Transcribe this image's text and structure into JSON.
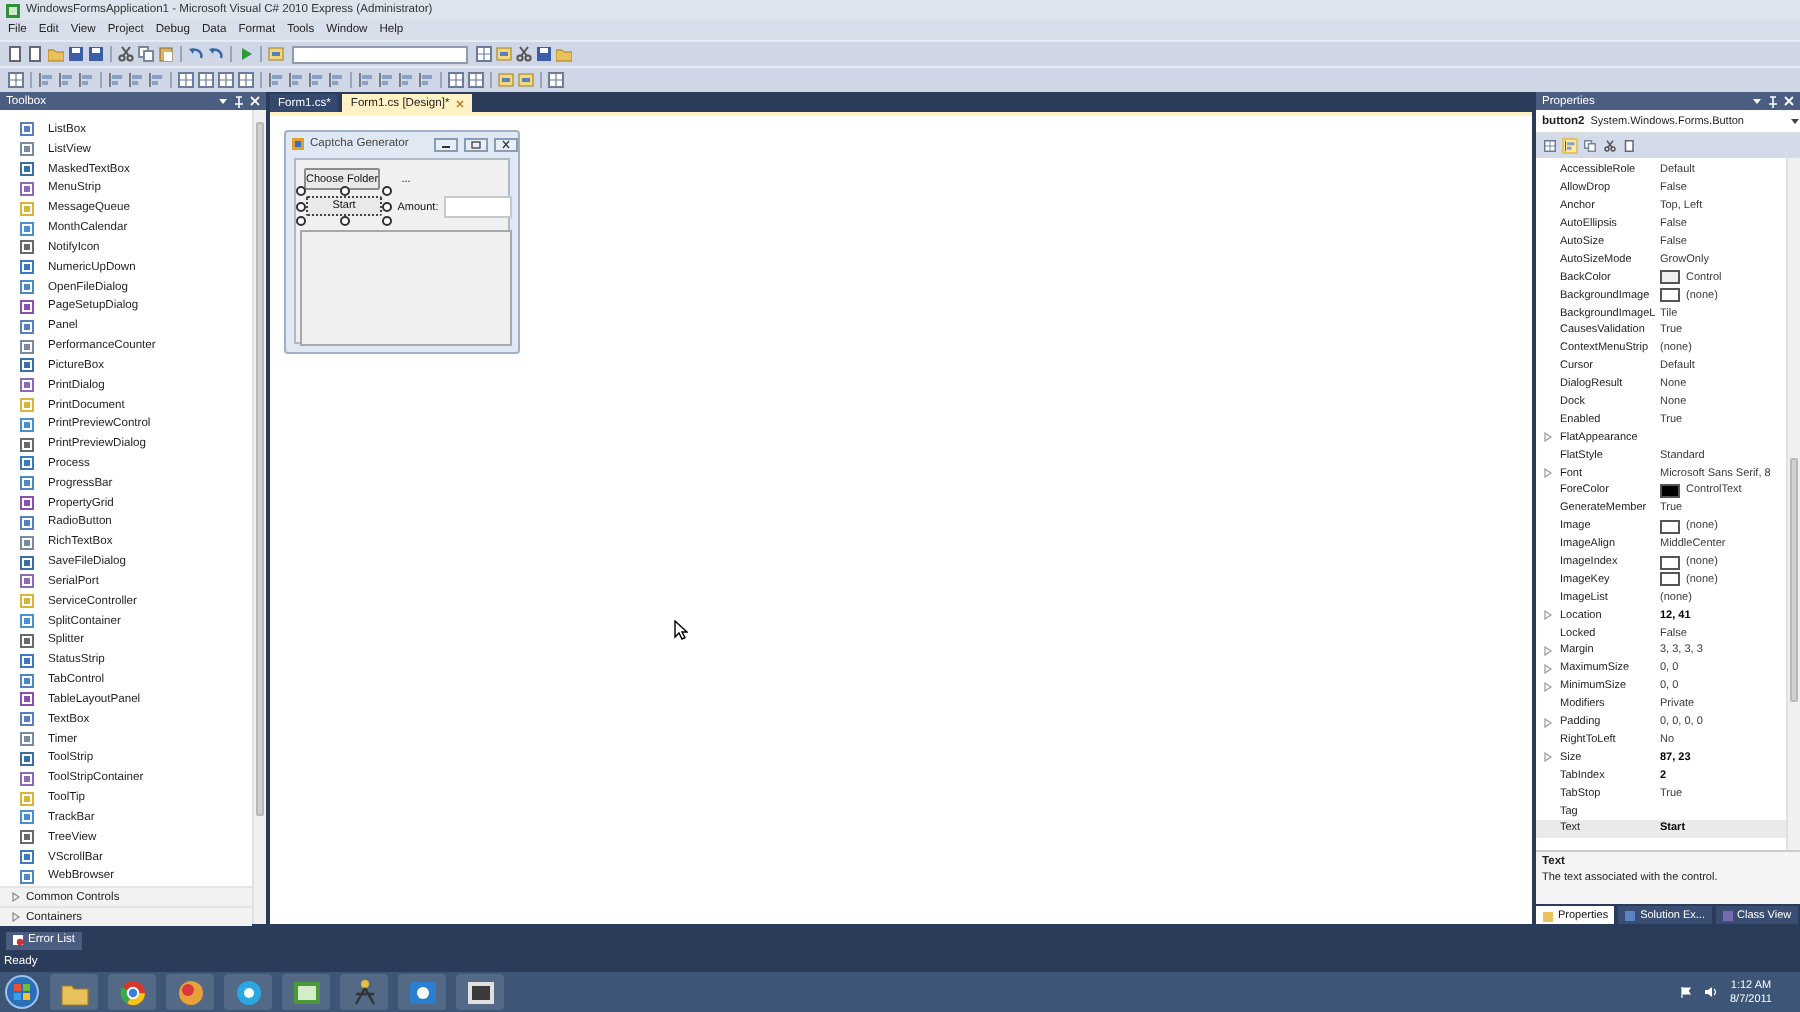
{
  "window": {
    "title": "WindowsFormsApplication1 - Microsoft Visual C# 2010 Express (Administrator)"
  },
  "menu": [
    "File",
    "Edit",
    "View",
    "Project",
    "Debug",
    "Data",
    "Format",
    "Tools",
    "Window",
    "Help"
  ],
  "toolbox": {
    "title": "Toolbox",
    "items": [
      "ListBox",
      "ListView",
      "MaskedTextBox",
      "MenuStrip",
      "MessageQueue",
      "MonthCalendar",
      "NotifyIcon",
      "NumericUpDown",
      "OpenFileDialog",
      "PageSetupDialog",
      "Panel",
      "PerformanceCounter",
      "PictureBox",
      "PrintDialog",
      "PrintDocument",
      "PrintPreviewControl",
      "PrintPreviewDialog",
      "Process",
      "ProgressBar",
      "PropertyGrid",
      "RadioButton",
      "RichTextBox",
      "SaveFileDialog",
      "SerialPort",
      "ServiceController",
      "SplitContainer",
      "Splitter",
      "StatusStrip",
      "TabControl",
      "TableLayoutPanel",
      "TextBox",
      "Timer",
      "ToolStrip",
      "ToolStripContainer",
      "ToolTip",
      "TrackBar",
      "TreeView",
      "VScrollBar",
      "WebBrowser"
    ],
    "groups": [
      {
        "label": "Common Controls",
        "expanded": false
      },
      {
        "label": "Containers",
        "expanded": false
      }
    ]
  },
  "documents": {
    "tabs": [
      {
        "label": "Form1.cs*",
        "selected": false
      },
      {
        "label": "Form1.cs [Design]*",
        "selected": true
      }
    ]
  },
  "form": {
    "title": "Captcha Generator",
    "controls": [
      {
        "kind": "button",
        "text": "Choose Folder",
        "selected": false
      },
      {
        "kind": "label",
        "text": "..."
      },
      {
        "kind": "button",
        "text": "Start",
        "selected": true
      },
      {
        "kind": "label",
        "text": "Amount:"
      },
      {
        "kind": "textbox"
      },
      {
        "kind": "listbox"
      }
    ]
  },
  "properties": {
    "title": "Properties",
    "object_name": "button2",
    "object_type": "System.Windows.Forms.Button",
    "view_buttons": [
      {
        "selected": false
      },
      {
        "selected": true
      },
      {
        "selected": false
      },
      {
        "selected": false
      },
      {
        "selected": false
      }
    ],
    "rows": [
      {
        "name": "AccessibleRole",
        "value": "Default",
        "expandable": false,
        "modified": false,
        "selected": false
      },
      {
        "name": "AllowDrop",
        "value": "False",
        "expandable": false,
        "modified": false,
        "selected": false
      },
      {
        "name": "Anchor",
        "value": "Top, Left",
        "expandable": false,
        "modified": false,
        "selected": false
      },
      {
        "name": "AutoEllipsis",
        "value": "False",
        "expandable": false,
        "modified": false,
        "selected": false
      },
      {
        "name": "AutoSize",
        "value": "False",
        "expandable": false,
        "modified": false,
        "selected": false
      },
      {
        "name": "AutoSizeMode",
        "value": "GrowOnly",
        "expandable": false,
        "modified": false,
        "selected": false
      },
      {
        "name": "BackColor",
        "value": "Control",
        "color": "#f0f0f0",
        "expandable": false,
        "modified": false,
        "selected": false
      },
      {
        "name": "BackgroundImage",
        "value": "(none)",
        "color": "#ffffff",
        "expandable": false,
        "modified": false,
        "selected": false
      },
      {
        "name": "BackgroundImageL",
        "value": "Tile",
        "expandable": false,
        "modified": false,
        "selected": false
      },
      {
        "name": "CausesValidation",
        "value": "True",
        "expandable": false,
        "modified": false,
        "selected": false
      },
      {
        "name": "ContextMenuStrip",
        "value": "(none)",
        "expandable": false,
        "modified": false,
        "selected": false
      },
      {
        "name": "Cursor",
        "value": "Default",
        "expandable": false,
        "modified": false,
        "selected": false
      },
      {
        "name": "DialogResult",
        "value": "None",
        "expandable": false,
        "modified": false,
        "selected": false
      },
      {
        "name": "Dock",
        "value": "None",
        "expandable": false,
        "modified": false,
        "selected": false
      },
      {
        "name": "Enabled",
        "value": "True",
        "expandable": false,
        "modified": false,
        "selected": false
      },
      {
        "name": "FlatAppearance",
        "expandable": true,
        "selected": false
      },
      {
        "name": "FlatStyle",
        "value": "Standard",
        "expandable": false,
        "modified": false,
        "selected": false
      },
      {
        "name": "Font",
        "value": "Microsoft Sans Serif, 8",
        "expandable": true,
        "modified": false,
        "selected": false
      },
      {
        "name": "ForeColor",
        "value": "ControlText",
        "color": "#000000",
        "expandable": false,
        "modified": false,
        "selected": false
      },
      {
        "name": "GenerateMember",
        "value": "True",
        "expandable": false,
        "modified": false,
        "selected": false
      },
      {
        "name": "Image",
        "value": "(none)",
        "color": "#ffffff",
        "expandable": false,
        "modified": false,
        "selected": false
      },
      {
        "name": "ImageAlign",
        "value": "MiddleCenter",
        "expandable": false,
        "modified": false,
        "selected": false
      },
      {
        "name": "ImageIndex",
        "value": "(none)",
        "color": "#ffffff",
        "expandable": false,
        "modified": false,
        "selected": false
      },
      {
        "name": "ImageKey",
        "value": "(none)",
        "color": "#ffffff",
        "expandable": false,
        "modified": false,
        "selected": false
      },
      {
        "name": "ImageList",
        "value": "(none)",
        "expandable": false,
        "modified": false,
        "selected": false
      },
      {
        "name": "Location",
        "value": "12, 41",
        "expandable": true,
        "modified": true,
        "selected": false
      },
      {
        "name": "Locked",
        "value": "False",
        "expandable": false,
        "modified": false,
        "selected": false
      },
      {
        "name": "Margin",
        "value": "3, 3, 3, 3",
        "expandable": true,
        "modified": false,
        "selected": false
      },
      {
        "name": "MaximumSize",
        "value": "0, 0",
        "expandable": true,
        "modified": false,
        "selected": false
      },
      {
        "name": "MinimumSize",
        "value": "0, 0",
        "expandable": true,
        "modified": false,
        "selected": false
      },
      {
        "name": "Modifiers",
        "value": "Private",
        "expandable": false,
        "modified": false,
        "selected": false
      },
      {
        "name": "Padding",
        "value": "0, 0, 0, 0",
        "expandable": true,
        "modified": false,
        "selected": false
      },
      {
        "name": "RightToLeft",
        "value": "No",
        "expandable": false,
        "modified": false,
        "selected": false
      },
      {
        "name": "Size",
        "value": "87, 23",
        "expandable": true,
        "modified": true,
        "selected": false
      },
      {
        "name": "TabIndex",
        "value": "2",
        "expandable": false,
        "modified": true,
        "selected": false
      },
      {
        "name": "TabStop",
        "value": "True",
        "expandable": false,
        "modified": false,
        "selected": false
      },
      {
        "name": "Tag",
        "expandable": false,
        "selected": false
      },
      {
        "name": "Text",
        "value": "Start",
        "expandable": false,
        "modified": true,
        "selected": true
      }
    ],
    "description_title": "Text",
    "description": "The text associated with the control.",
    "tabs": [
      {
        "label": "Properties",
        "selected": true
      },
      {
        "label": "Solution Ex...",
        "selected": false
      },
      {
        "label": "Class View",
        "selected": false
      }
    ]
  },
  "error_list": "Error List",
  "status_bar": "Ready",
  "clock": {
    "time": "1:12 AM",
    "date": "8/7/2011"
  }
}
